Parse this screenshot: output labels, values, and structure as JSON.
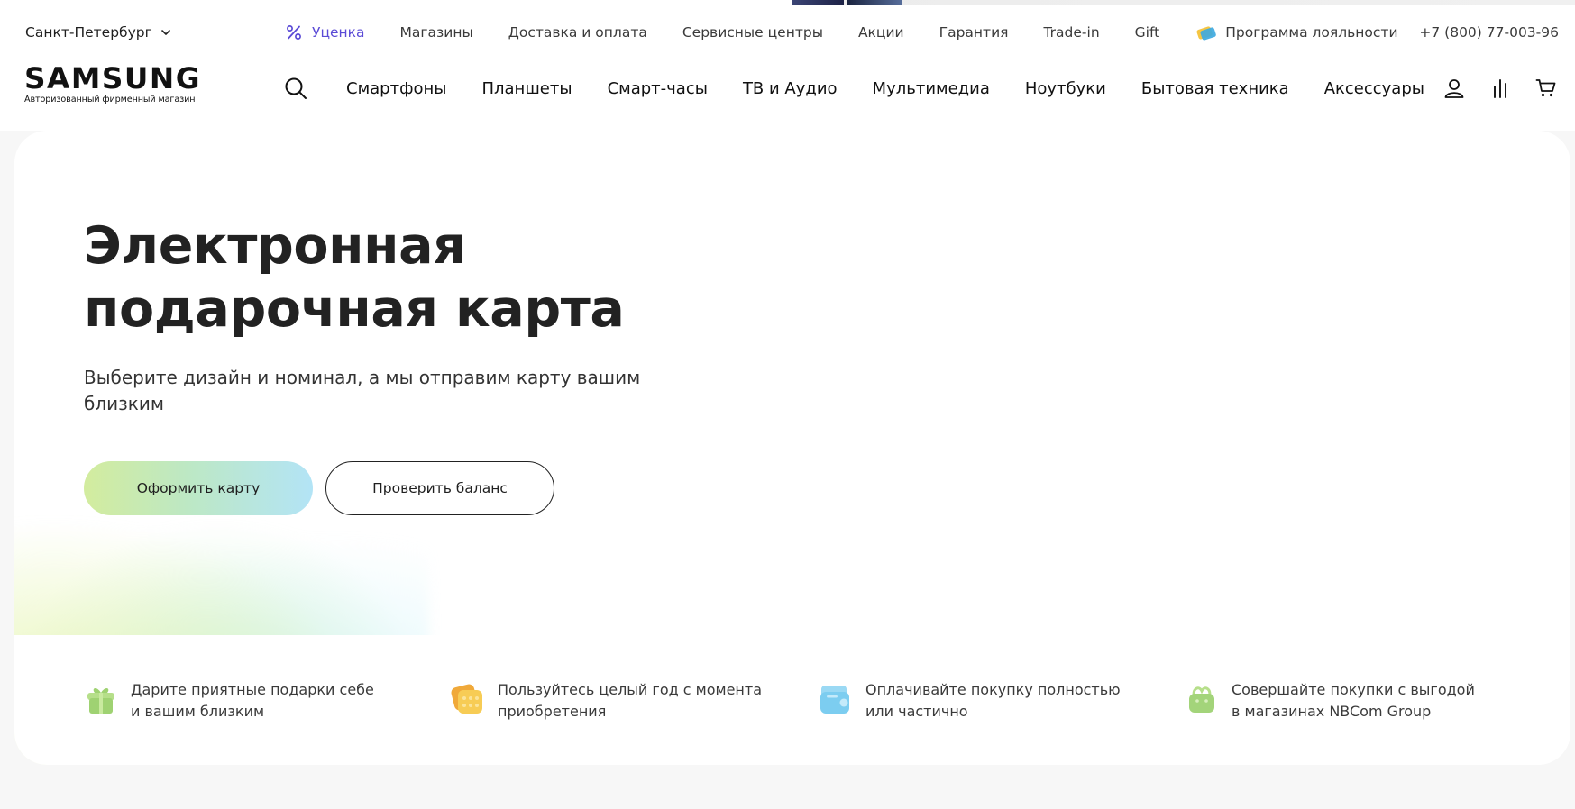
{
  "topbar": {
    "city": "Санкт-Петербург",
    "links": [
      {
        "label": "Уценка",
        "type": "discount"
      },
      {
        "label": "Магазины"
      },
      {
        "label": "Доставка и оплата"
      },
      {
        "label": "Сервисные центры"
      },
      {
        "label": "Акции"
      },
      {
        "label": "Гарантия"
      },
      {
        "label": "Trade-in"
      },
      {
        "label": "Gift"
      },
      {
        "label": "Программа лояльности",
        "type": "loyalty"
      }
    ],
    "phone": "+7 (800) 77-003-96"
  },
  "logo": {
    "word": "SAMSUNG",
    "subtitle": "Авторизованный фирменный магазин"
  },
  "mainnav": {
    "items": [
      "Смартфоны",
      "Планшеты",
      "Смарт-часы",
      "ТВ и Аудио",
      "Мультимедиа",
      "Ноутбуки",
      "Бытовая техника",
      "Аксессуары"
    ]
  },
  "hero": {
    "title_line1": "Электронная",
    "title_line2": "подарочная карта",
    "subtitle_line1": "Выберите дизайн и номинал, а мы отправим карту вашим",
    "subtitle_line2": "близким",
    "primary_button": "Оформить карту",
    "secondary_button": "Проверить баланс"
  },
  "features": [
    {
      "icon": "gift-icon",
      "line1": "Дарите приятные подарки себе",
      "line2": "и вашим близким",
      "color": "#a8d67a"
    },
    {
      "icon": "calendar-icon",
      "line1": "Пользуйтесь целый год с момента",
      "line2": "приобретения",
      "color": "#f5c542"
    },
    {
      "icon": "wallet-icon",
      "line1": "Оплачивайте покупку полностью",
      "line2": "или частично",
      "color": "#7ccdf0"
    },
    {
      "icon": "shopping-bag-icon",
      "line1": "Совершайте покупки с выгодой",
      "line2": "в магазинах NBCom Group",
      "color": "#a8d67a"
    }
  ],
  "colors": {
    "accent_discount": "#5b4bd6",
    "page_background": "#f7f7f7",
    "text": "#1f1f1f"
  }
}
